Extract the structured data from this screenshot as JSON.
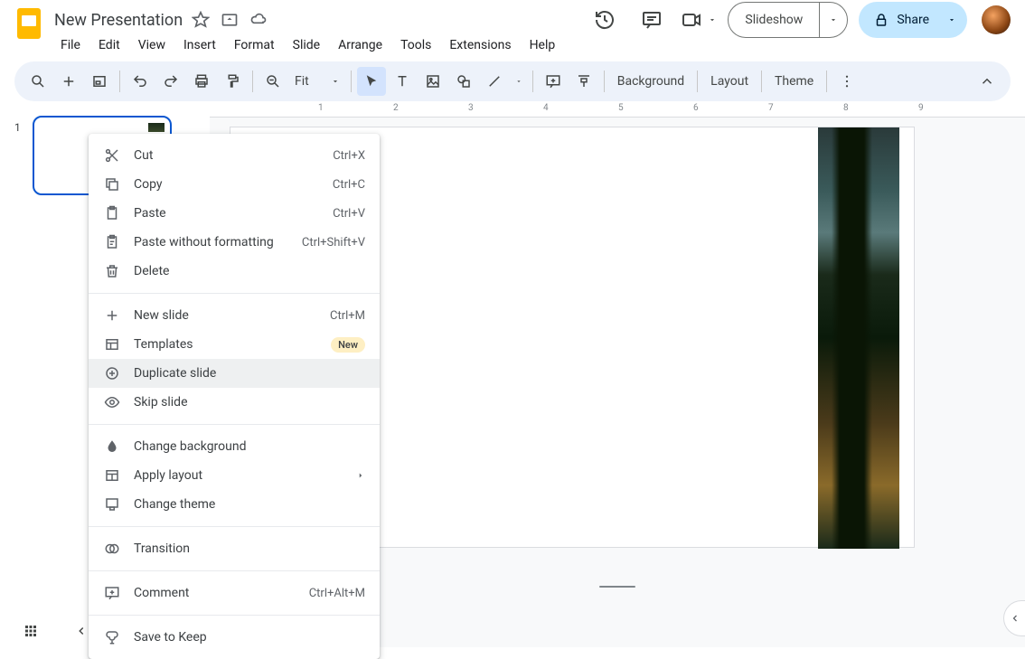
{
  "doc": {
    "title": "New Presentation"
  },
  "menus": [
    "File",
    "Edit",
    "View",
    "Insert",
    "Format",
    "Slide",
    "Arrange",
    "Tools",
    "Extensions",
    "Help"
  ],
  "toolbar": {
    "zoom": "Fit",
    "background": "Background",
    "layout": "Layout",
    "theme": "Theme"
  },
  "header": {
    "slideshow": "Slideshow",
    "share": "Share"
  },
  "sidebar": {
    "slides": [
      {
        "number": "1"
      }
    ]
  },
  "ruler": [
    "1",
    "2",
    "3",
    "4",
    "5",
    "6",
    "7",
    "8",
    "9"
  ],
  "context_menu": {
    "cut": {
      "label": "Cut",
      "shortcut": "Ctrl+X"
    },
    "copy": {
      "label": "Copy",
      "shortcut": "Ctrl+C"
    },
    "paste": {
      "label": "Paste",
      "shortcut": "Ctrl+V"
    },
    "paste_plain": {
      "label": "Paste without formatting",
      "shortcut": "Ctrl+Shift+V"
    },
    "delete": {
      "label": "Delete"
    },
    "new_slide": {
      "label": "New slide",
      "shortcut": "Ctrl+M"
    },
    "templates": {
      "label": "Templates",
      "badge": "New"
    },
    "duplicate": {
      "label": "Duplicate slide"
    },
    "skip": {
      "label": "Skip slide"
    },
    "change_bg": {
      "label": "Change background"
    },
    "apply_layout": {
      "label": "Apply layout"
    },
    "change_theme": {
      "label": "Change theme"
    },
    "transition": {
      "label": "Transition"
    },
    "comment": {
      "label": "Comment",
      "shortcut": "Ctrl+Alt+M"
    },
    "save_keep": {
      "label": "Save to Keep"
    }
  }
}
